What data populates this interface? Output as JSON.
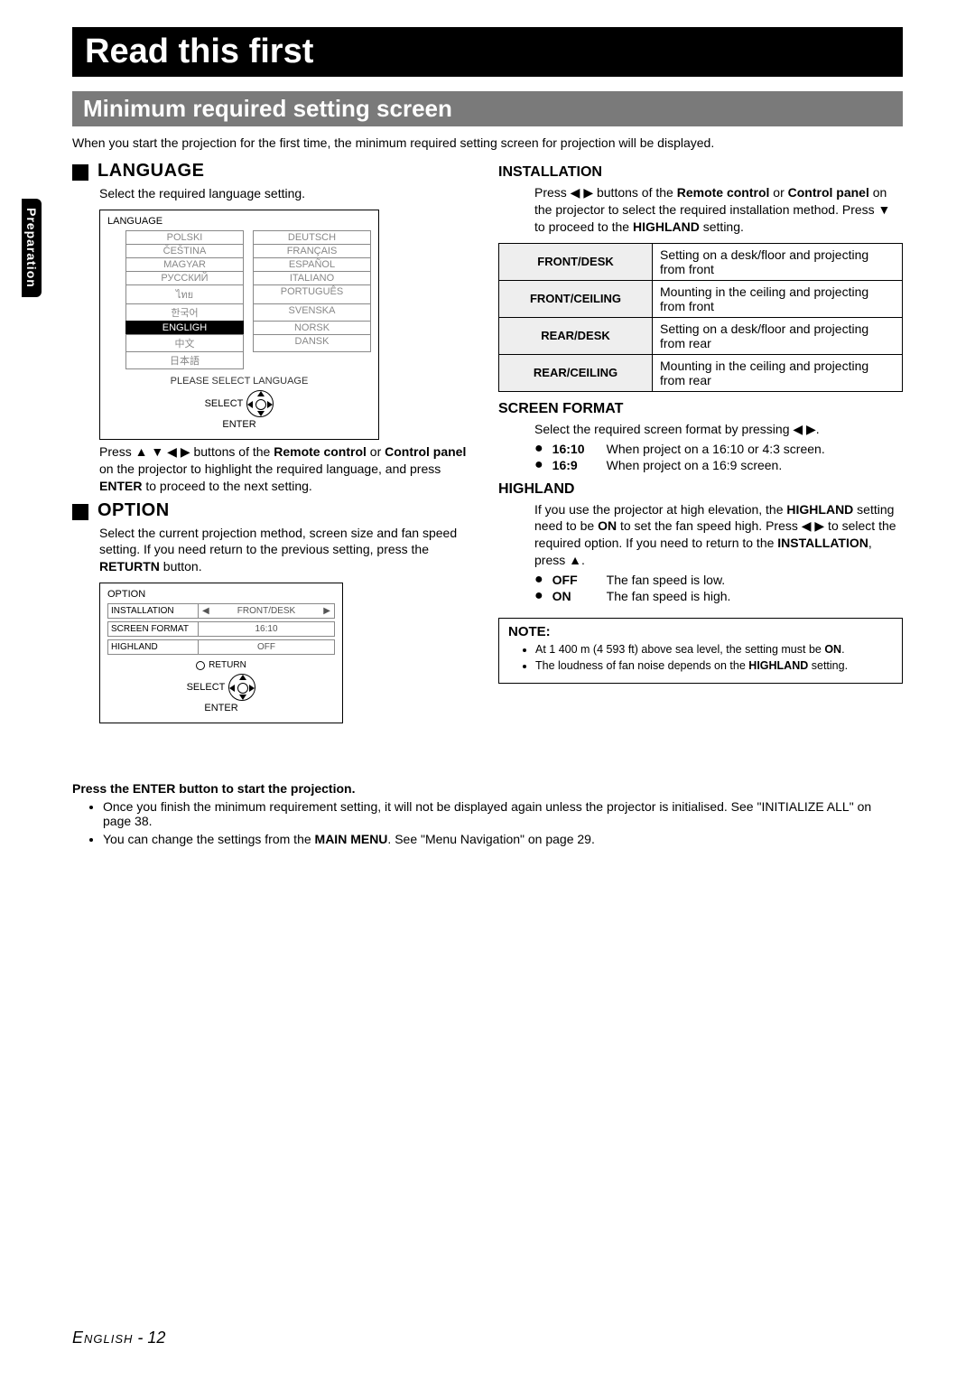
{
  "title": "Read this first",
  "section": "Minimum required setting screen",
  "intro": "When you start the projection for the first time, the minimum required setting screen for projection will be displayed.",
  "sideTab": "Preparation",
  "language": {
    "heading": "LANGUAGE",
    "desc": "Select the required language setting.",
    "boxTitle": "LANGUAGE",
    "items": [
      [
        "POLSKI",
        "DEUTSCH"
      ],
      [
        "ČEŠTINA",
        "FRANÇAIS"
      ],
      [
        "MAGYAR",
        "ESPAÑOL"
      ],
      [
        "РУССКИЙ",
        "ITALIANO"
      ],
      [
        "ไทย",
        "PORTUGUÊS"
      ],
      [
        "한국어",
        "SVENSKA"
      ],
      [
        "ENGLIGH",
        "NORSK"
      ],
      [
        "中文",
        "DANSK"
      ],
      [
        "日本語",
        ""
      ]
    ],
    "selectedIndex": [
      6,
      0
    ],
    "pleaseSelect": "PLEASE SELECT LANGUAGE",
    "selectLabel": "SELECT",
    "enterLabel": "ENTER",
    "instr_a": "Press ▲ ▼ ◀ ▶ buttons of the ",
    "instr_b": "Remote control",
    "instr_c": " or ",
    "instr_d": "Control panel",
    "instr_e": " on the projector to highlight the required language, and press ",
    "instr_f": "ENTER",
    "instr_g": " to proceed to the next setting."
  },
  "option": {
    "heading": "OPTION",
    "desc_a": "Select the current projection method, screen size and fan speed setting. If you need return to the previous setting, press the ",
    "desc_b": "RETURTN",
    "desc_c": " button.",
    "boxTitle": "OPTION",
    "rows": [
      {
        "label": "INSTALLATION",
        "value": "FRONT/DESK",
        "arrows": true
      },
      {
        "label": "SCREEN FORMAT",
        "value": "16:10",
        "arrows": false
      },
      {
        "label": "HIGHLAND",
        "value": "OFF",
        "arrows": false
      }
    ],
    "returnLabel": "RETURN",
    "selectLabel": "SELECT",
    "enterLabel": "ENTER"
  },
  "installation": {
    "heading": "INSTALLATION",
    "desc_a": "Press ◀ ▶ buttons of the ",
    "desc_b": "Remote control",
    "desc_c": " or ",
    "desc_d": "Control panel",
    "desc_e": " on the projector to select the required installation method. Press ▼ to proceed to the ",
    "desc_f": "HIGHLAND",
    "desc_g": " setting.",
    "rows": [
      {
        "k": "FRONT/DESK",
        "v": "Setting on a desk/floor and projecting from front"
      },
      {
        "k": "FRONT/CEILING",
        "v": "Mounting in the ceiling and projecting from front"
      },
      {
        "k": "REAR/DESK",
        "v": "Setting on a desk/floor and projecting from rear"
      },
      {
        "k": "REAR/CEILING",
        "v": "Mounting in the ceiling and projecting from rear"
      }
    ]
  },
  "screenFormat": {
    "heading": "SCREEN FORMAT",
    "desc": "Select the required screen format by pressing ◀ ▶.",
    "items": [
      {
        "k": "16:10",
        "v": "When project on a 16:10 or 4:3 screen."
      },
      {
        "k": "16:9",
        "v": "When project on a 16:9 screen."
      }
    ]
  },
  "highland": {
    "heading": "HIGHLAND",
    "desc_a": "If you use the projector at high elevation, the ",
    "desc_b": "HIGHLAND",
    "desc_c": " setting need to be ",
    "desc_d": "ON",
    "desc_e": " to set the fan speed high. Press ◀ ▶ to select the required option. If you need to return to the ",
    "desc_f": "INSTALLATION",
    "desc_g": ", press ▲.",
    "items": [
      {
        "k": "OFF",
        "v": "The fan speed is low."
      },
      {
        "k": "ON",
        "v": "The fan speed is high."
      }
    ]
  },
  "note": {
    "heading": "NOTE:",
    "items_a": "At 1 400 m (4 593 ft) above sea level, the setting must be ",
    "items_a_b": "ON",
    "items_a_c": ".",
    "items_b": "The loudness of fan noise depends on the ",
    "items_b_b": "HIGHLAND",
    "items_b_c": " setting."
  },
  "final": {
    "hdr": "Press the ENTER button to start the projection.",
    "li1_a": "Once you finish the minimum requirement setting, it will not be displayed again unless the projector is initialised. See \"INITIALIZE ALL\" on page 38.",
    "li2_a": "You can change the settings from the ",
    "li2_b": "MAIN MENU",
    "li2_c": ". See \"Menu Navigation\" on page 29."
  },
  "footer": {
    "lang": "English",
    "sep": " - ",
    "page": "12"
  }
}
